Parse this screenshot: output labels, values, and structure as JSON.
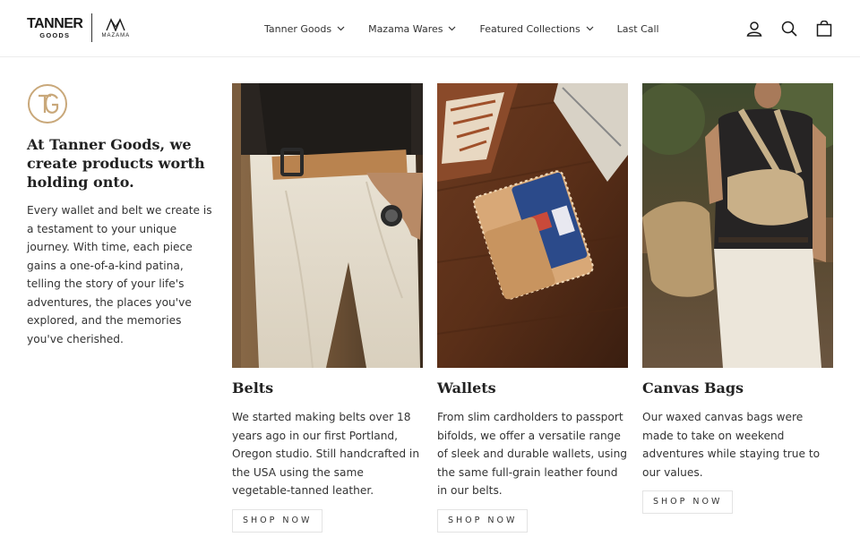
{
  "brand": {
    "tanner_line1": "TANNER",
    "tanner_line2": "GOODS",
    "mazama": "MAZAMA"
  },
  "nav": {
    "items": [
      {
        "label": "Tanner Goods",
        "has_dropdown": true
      },
      {
        "label": "Mazama Wares",
        "has_dropdown": true
      },
      {
        "label": "Featured Collections",
        "has_dropdown": true
      },
      {
        "label": "Last Call",
        "has_dropdown": false
      }
    ]
  },
  "header_icons": [
    "account-icon",
    "search-icon",
    "cart-icon"
  ],
  "intro": {
    "monogram_icon": "tg-monogram-icon",
    "title": "At Tanner Goods, we create products worth holding onto.",
    "body": "Every wallet and belt we create is a testament to your unique journey. With time, each piece gains a one-of-a-kind patina, telling the story of your life's adventures, the places you've explored, and the memories you've cherished."
  },
  "collections": [
    {
      "title": "Belts",
      "body": "We started making belts over 18 years ago in our first Portland, Oregon studio. Still handcrafted in the USA using the same vegetable-tanned leather.",
      "cta": "SHOP NOW"
    },
    {
      "title": "Wallets",
      "body": "From slim cardholders to passport bifolds, we offer a versatile range of sleek and durable wallets, using the same full-grain leather found in our belts.",
      "cta": "SHOP NOW"
    },
    {
      "title": "Canvas Bags",
      "body": "Our waxed canvas bags were made to take on weekend adventures while staying true to our values.",
      "cta": "SHOP NOW"
    }
  ],
  "colors": {
    "text": "#222222",
    "accent_gold": "#c9a87a",
    "border": "#e3e3e3"
  }
}
